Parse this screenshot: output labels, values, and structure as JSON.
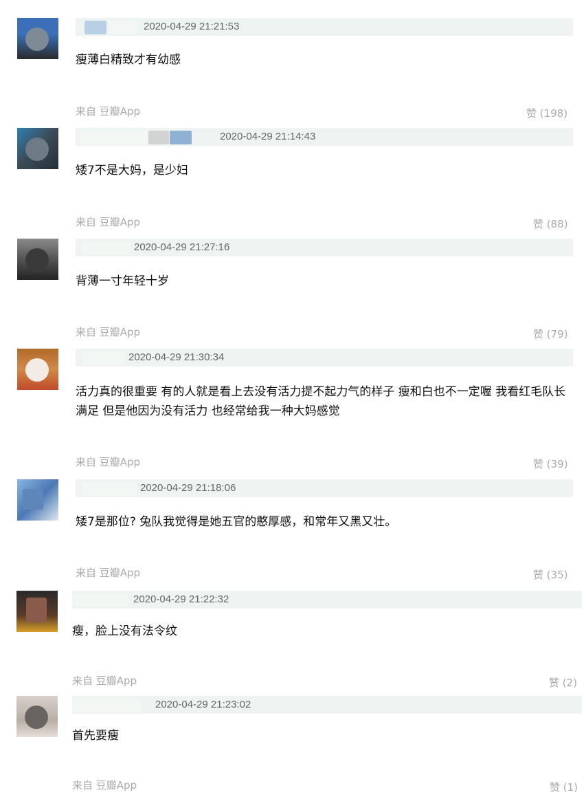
{
  "comments": [
    {
      "timestamp": "2020-04-29 21:21:53",
      "text": "瘦薄白精致才有幼感",
      "source": "来自 豆瓣App",
      "like_label": "赞",
      "like_count": "(198)"
    },
    {
      "timestamp": "2020-04-29 21:14:43",
      "text": "矮7不是大妈，是少妇",
      "source": "来自 豆瓣App",
      "like_label": "赞",
      "like_count": "(88)"
    },
    {
      "timestamp": "2020-04-29 21:27:16",
      "text": "背薄一寸年轻十岁",
      "source": "来自 豆瓣App",
      "like_label": "赞",
      "like_count": "(79)"
    },
    {
      "timestamp": "2020-04-29 21:30:34",
      "text": "活力真的很重要 有的人就是看上去没有活力提不起力气的样子 瘦和白也不一定喔 我看红毛队长满足 但是他因为没有活力 也经常给我一种大妈感觉",
      "source": "来自 豆瓣App",
      "like_label": "赞",
      "like_count": "(39)"
    },
    {
      "timestamp": "2020-04-29 21:18:06",
      "text": "矮7是那位? 兔队我觉得是她五官的憨厚感，和常年又黑又壮。",
      "source": "来自 豆瓣App",
      "like_label": "赞",
      "like_count": "(35)"
    },
    {
      "timestamp": "2020-04-29 21:22:32",
      "text": "瘦，脸上没有法令纹",
      "source": "来自 豆瓣App",
      "like_label": "赞",
      "like_count": "(2)"
    },
    {
      "timestamp": "2020-04-29 21:23:02",
      "text": "首先要瘦",
      "source": "来自 豆瓣App",
      "like_label": "赞",
      "like_count": "(1)"
    }
  ],
  "colors": {
    "header_bar": "#eef4f1",
    "timestamp": "#666666",
    "meta": "#aaaaaa",
    "text": "#111111"
  }
}
